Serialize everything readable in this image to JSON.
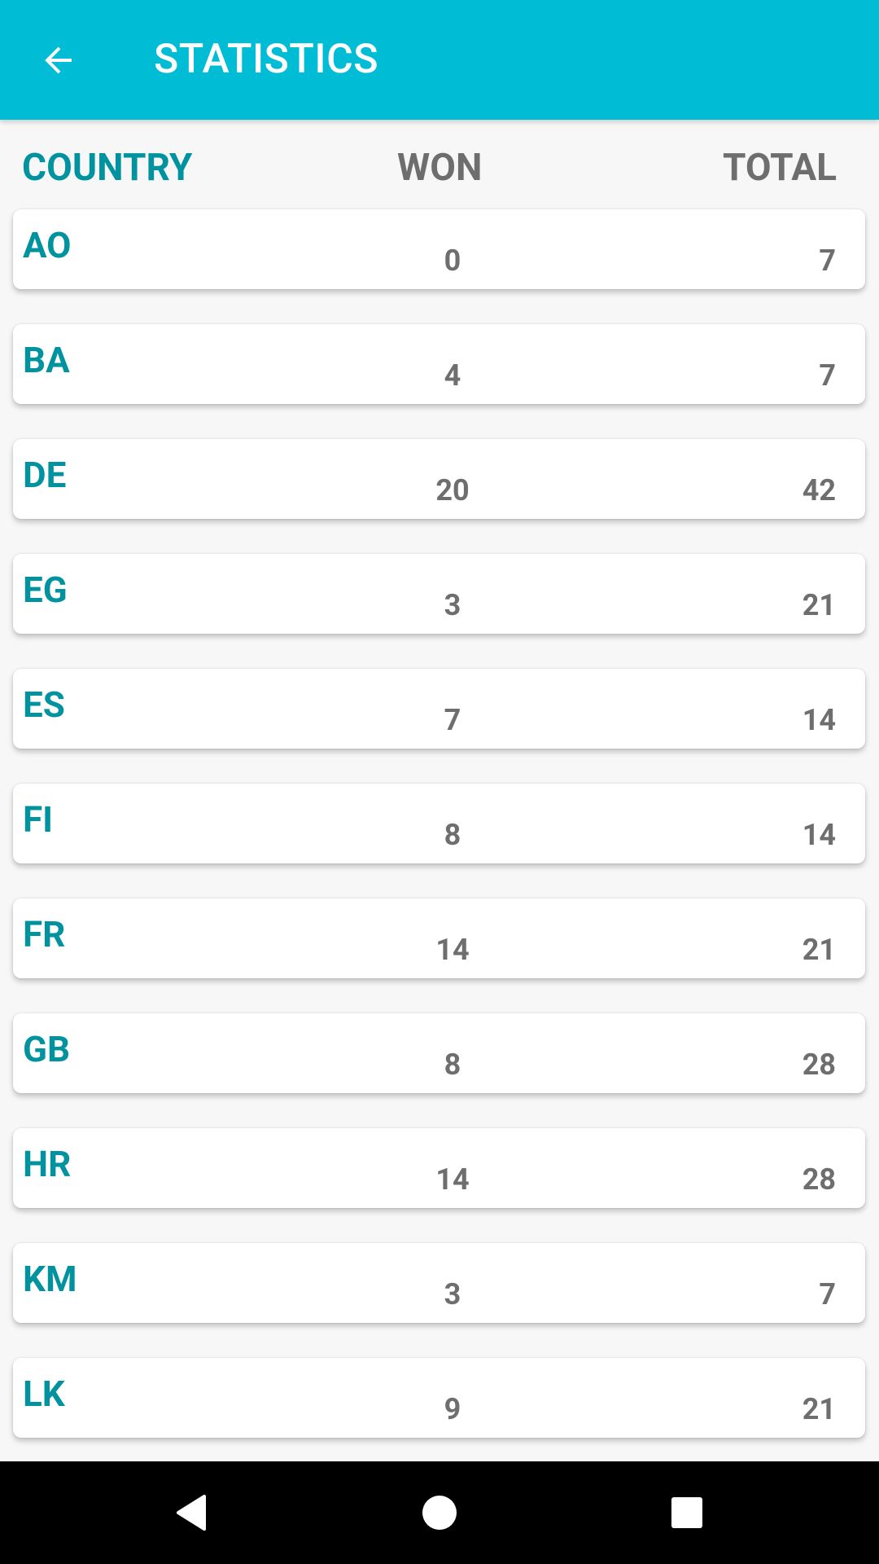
{
  "appbar": {
    "title": "STATISTICS",
    "back_icon": "arrow-left-icon",
    "background": "#00bcd4"
  },
  "table": {
    "headers": {
      "country": "COUNTRY",
      "won": "WON",
      "total": "TOTAL"
    },
    "rows": [
      {
        "country": "AO",
        "won": "0",
        "total": "7"
      },
      {
        "country": "BA",
        "won": "4",
        "total": "7"
      },
      {
        "country": "DE",
        "won": "20",
        "total": "42"
      },
      {
        "country": "EG",
        "won": "3",
        "total": "21"
      },
      {
        "country": "ES",
        "won": "7",
        "total": "14"
      },
      {
        "country": "FI",
        "won": "8",
        "total": "14"
      },
      {
        "country": "FR",
        "won": "14",
        "total": "21"
      },
      {
        "country": "GB",
        "won": "8",
        "total": "28"
      },
      {
        "country": "HR",
        "won": "14",
        "total": "28"
      },
      {
        "country": "KM",
        "won": "3",
        "total": "7"
      },
      {
        "country": "LK",
        "won": "9",
        "total": "21"
      }
    ]
  },
  "colors": {
    "accent": "#00939f",
    "muted_text": "#6e6e6e",
    "card": "#ffffff",
    "background": "#f7f7f7"
  },
  "navbar": {
    "icons": [
      "nav-back-icon",
      "nav-home-icon",
      "nav-recents-icon"
    ]
  }
}
